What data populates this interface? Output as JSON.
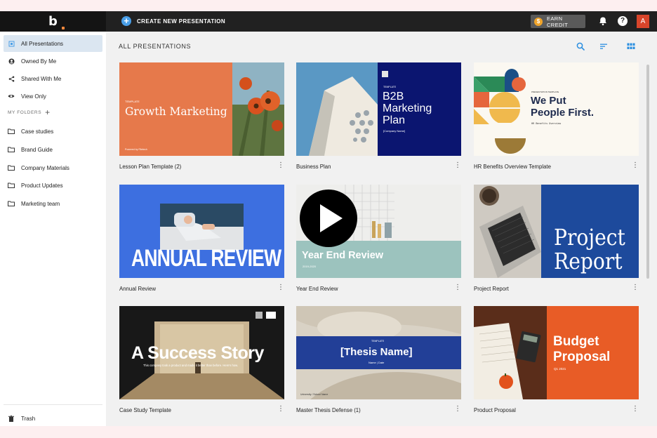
{
  "topbar": {
    "logo": "b",
    "create_label": "CREATE NEW PRESENTATION",
    "earn_label": "EARN CREDIT",
    "avatar_initial": "A"
  },
  "sidebar": {
    "items": [
      {
        "label": "All Presentations",
        "icon": "presentations-icon"
      },
      {
        "label": "Owned By Me",
        "icon": "user-icon"
      },
      {
        "label": "Shared With Me",
        "icon": "share-icon"
      },
      {
        "label": "View Only",
        "icon": "eye-icon"
      }
    ],
    "folders_label": "MY FOLDERS",
    "folders": [
      {
        "label": "Case studies"
      },
      {
        "label": "Brand Guide"
      },
      {
        "label": "Company Materials"
      },
      {
        "label": "Product Updates"
      },
      {
        "label": "Marketing team"
      }
    ],
    "trash_label": "Trash"
  },
  "main": {
    "title": "ALL PRESENTATIONS",
    "cards": [
      {
        "title": "Lesson Plan Template (2)",
        "thumb": {
          "tag": "TEMPLATE",
          "heading": "Growth Marketing",
          "footer": "Powered by Filetech"
        }
      },
      {
        "title": "Business Plan",
        "thumb": {
          "tag": "TEMPLATE",
          "heading1": "B2B",
          "heading2": "Marketing",
          "heading3": "Plan",
          "sub": "[Company Name]"
        }
      },
      {
        "title": "HR Benefits Overview Template",
        "thumb": {
          "tag": "PRESENTATION TEMPLATE",
          "heading1": "We Put",
          "heading2": "People First.",
          "sub": "HR Benefits Overview"
        }
      },
      {
        "title": "Annual Review",
        "thumb": {
          "heading": "ANNUAL REVIEW"
        }
      },
      {
        "title": "Year End Review",
        "thumb": {
          "heading": "Year End Review",
          "sub": "2019-2020"
        }
      },
      {
        "title": "Project Report",
        "thumb": {
          "heading1": "Project",
          "heading2": "Report"
        }
      },
      {
        "title": "Case Study Template",
        "thumb": {
          "heading": "A Success Story",
          "sub": "This company took a product and made it better than before. Here's how."
        }
      },
      {
        "title": "Master Thesis Defense (1)",
        "thumb": {
          "tag": "TEMPLATE",
          "heading": "[Thesis Name]",
          "sub": "Name  |  Date",
          "footer": "University / School Name"
        }
      },
      {
        "title": "Product Proposal",
        "thumb": {
          "heading1": "Budget",
          "heading2": "Proposal",
          "sub": "Q1 2021"
        }
      }
    ]
  },
  "colors": {
    "topbar": "#212121",
    "accent_blue": "#4a9fe8",
    "coin": "#f0a42a",
    "avatar": "#d8452b",
    "sidebar_active": "#dbe6f1"
  }
}
